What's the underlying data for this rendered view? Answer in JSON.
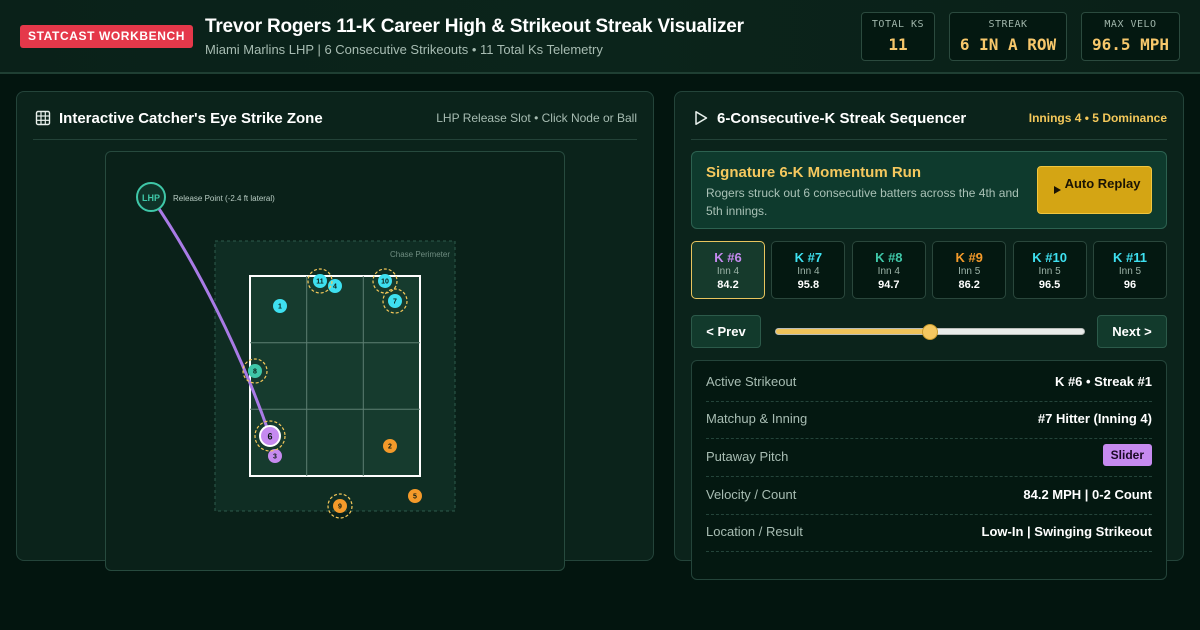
{
  "header": {
    "brand": "STATCAST WORKBENCH",
    "title": "Trevor Rogers 11-K Career High & Strikeout Streak Visualizer",
    "subtitle": "Miami Marlins LHP | 6 Consecutive Strikeouts • 11 Total Ks Telemetry",
    "stats": [
      {
        "label": "TOTAL KS",
        "value": "11"
      },
      {
        "label": "STREAK",
        "value": "6 IN A ROW"
      },
      {
        "label": "MAX VELO",
        "value": "96.5 MPH"
      }
    ]
  },
  "left_panel": {
    "title": "Interactive Catcher's Eye Strike Zone",
    "note": "LHP Release Slot • Click Node or Ball",
    "release_label": "LHP",
    "release_text": "Release Point (-2.4 ft lateral)",
    "chase_label": "Chase Perimeter",
    "pitches": [
      {
        "n": "1",
        "type": "cyan",
        "streak": false
      },
      {
        "n": "2",
        "type": "orange",
        "streak": false
      },
      {
        "n": "3",
        "type": "purple",
        "streak": false
      },
      {
        "n": "4",
        "type": "cyan",
        "streak": false
      },
      {
        "n": "5",
        "type": "orange",
        "streak": false
      },
      {
        "n": "6",
        "type": "purple",
        "streak": true,
        "active": true
      },
      {
        "n": "7",
        "type": "cyan",
        "streak": true
      },
      {
        "n": "8",
        "type": "teal",
        "streak": true
      },
      {
        "n": "9",
        "type": "orange",
        "streak": true
      },
      {
        "n": "10",
        "type": "cyan",
        "streak": true
      },
      {
        "n": "11",
        "type": "cyan",
        "streak": true
      }
    ]
  },
  "right_panel": {
    "title": "6-Consecutive-K Streak Sequencer",
    "note": "Innings 4 • 5 Dominance",
    "momentum": {
      "title": "Signature 6-K Momentum Run",
      "desc": "Rogers struck out 6 consecutive batters across the 4th and 5th innings.",
      "button": "Auto Replay"
    },
    "cards": [
      {
        "label": "K #6",
        "inning": "Inn 4",
        "velo": "84.2",
        "color": "#c68af0"
      },
      {
        "label": "K #7",
        "inning": "Inn 4",
        "velo": "95.8",
        "color": "#3ee0f0"
      },
      {
        "label": "K #8",
        "inning": "Inn 4",
        "velo": "94.7",
        "color": "#3fc7a8"
      },
      {
        "label": "K #9",
        "inning": "Inn 5",
        "velo": "86.2",
        "color": "#f49a2a"
      },
      {
        "label": "K #10",
        "inning": "Inn 5",
        "velo": "96.5",
        "color": "#3ee0f0"
      },
      {
        "label": "K #11",
        "inning": "Inn 5",
        "velo": "96",
        "color": "#3ee0f0"
      }
    ],
    "nav": {
      "prev": "< Prev",
      "next": "Next >",
      "slider_position": 0.5
    },
    "details": [
      {
        "key": "Active Strikeout",
        "value": "K #6 • Streak #1"
      },
      {
        "key": "Matchup & Inning",
        "value": "#7 Hitter (Inning 4)"
      },
      {
        "key": "Putaway Pitch",
        "value": "Slider",
        "badge": true
      },
      {
        "key": "Velocity / Count",
        "value": "84.2 MPH | 0-2 Count"
      },
      {
        "key": "Location / Result",
        "value": "Low-In | Swinging Strikeout"
      }
    ]
  },
  "colors": {
    "accent": "#f4c85a",
    "brand": "#e5384a",
    "cyan": "#3ee0f0",
    "teal": "#3fc7a8",
    "orange": "#f49a2a",
    "purple": "#c68af0"
  }
}
